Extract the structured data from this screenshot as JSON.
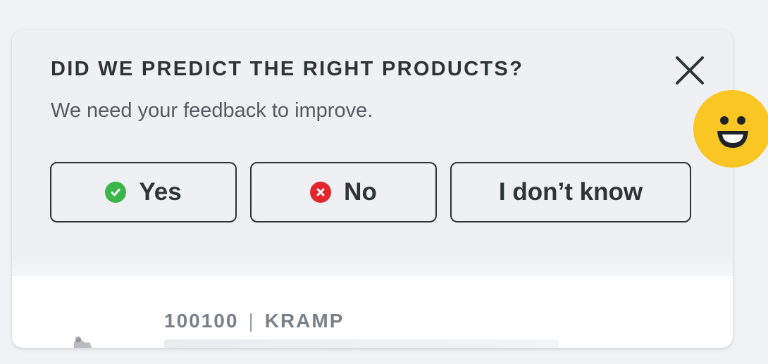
{
  "feedback": {
    "title": "DID WE PREDICT THE RIGHT PRODUCTS?",
    "subtitle": "We need your feedback to improve.",
    "buttons": {
      "yes": "Yes",
      "no": "No",
      "dont_know": "I don’t know"
    }
  },
  "product": {
    "sku": "100100",
    "separator": "|",
    "brand": "KRAMP"
  },
  "colors": {
    "yes_icon": "#3ab54a",
    "no_icon": "#e3262d",
    "smiley": "#f9c623"
  },
  "icons": {
    "close": "close-icon",
    "yes": "check-circle-icon",
    "no": "x-circle-icon",
    "smiley": "smiley-face-icon"
  }
}
